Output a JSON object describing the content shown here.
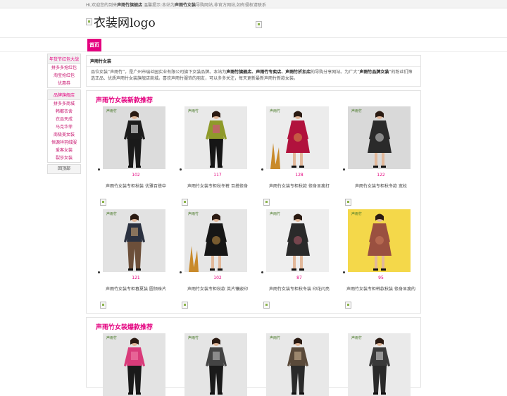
{
  "topbar": {
    "prefix": "Hi,欢迎您的到来",
    "store": "声雨竹旗舰店",
    "mid": " 温馨提示:本站为",
    "brand": "声雨竹女装",
    "suffix": "导购网站,非官方网站,如有侵权请联系"
  },
  "header": {
    "logo_alt": "衣装网logo"
  },
  "nav": {
    "home": "首页"
  },
  "sidebar": {
    "group1_title": "年货节红包大战",
    "group1_items": [
      "拼多多抢红包",
      "淘宝抢红包",
      "优惠券"
    ],
    "group2_title": "品牌旗舰店",
    "group2_items": [
      "拼多多商城",
      "韩都衣舍",
      "衣品天成",
      "马克华菲",
      "南极美女装",
      "恒源祥羽绒服",
      "爱客女装",
      "裂莎女装"
    ],
    "back_top": "回顶部"
  },
  "intro": {
    "title": "声雨竹女装",
    "p1": "品位女装“声雨竹”，是广州市瑞丝园实业有限公司旗下女装品牌。本站为",
    "b1": "声雨竹旗舰店、声雨竹专卖店、声雨竹折扣店",
    "p2": "的导购分享网站。为广大“",
    "b2": "声雨竹品牌女装",
    "p3": "”的粉丝们筛选正品、优质声雨竹女装旗舰店商城。喜欢声雨竹服饰的朋友，可以多多关注，每天更新最新声雨竹新款女装。"
  },
  "sections": [
    {
      "title": "声雨竹女装新款推荐",
      "products": [
        {
          "views": "102",
          "name": "声雨竹女装专柜秋装 优雅百搭中",
          "theme": "pants"
        },
        {
          "views": "117",
          "name": "声雨竹女装专柜秋冬裤 百搭修身",
          "theme": "green"
        },
        {
          "views": "128",
          "name": "声雨竹女装专柜秋款 修身显瘦打",
          "theme": "red"
        },
        {
          "views": "122",
          "name": "声雨竹女装专柜秋冬款 宽松",
          "theme": "lace"
        },
        {
          "views": "121",
          "name": "声雨竹女装专柜春夏装 圆领珠片",
          "theme": "print"
        },
        {
          "views": "102",
          "name": "声雨竹女装专柜秋款 英片镶嵌印",
          "theme": "black"
        },
        {
          "views": "87",
          "name": "声雨竹女装专柜秋冬装 印花闪亮",
          "theme": "floral"
        },
        {
          "views": "95",
          "name": "声雨竹女装专柜韩款秋装 修身显瘦的",
          "theme": "yellow"
        }
      ]
    },
    {
      "title": "声雨竹女装爆款推荐",
      "products": [
        {
          "theme": "pinkknit"
        },
        {
          "theme": "stripe"
        },
        {
          "theme": "leopard"
        },
        {
          "theme": "bw"
        }
      ]
    }
  ],
  "colors": {
    "accent": "#e4007f"
  }
}
